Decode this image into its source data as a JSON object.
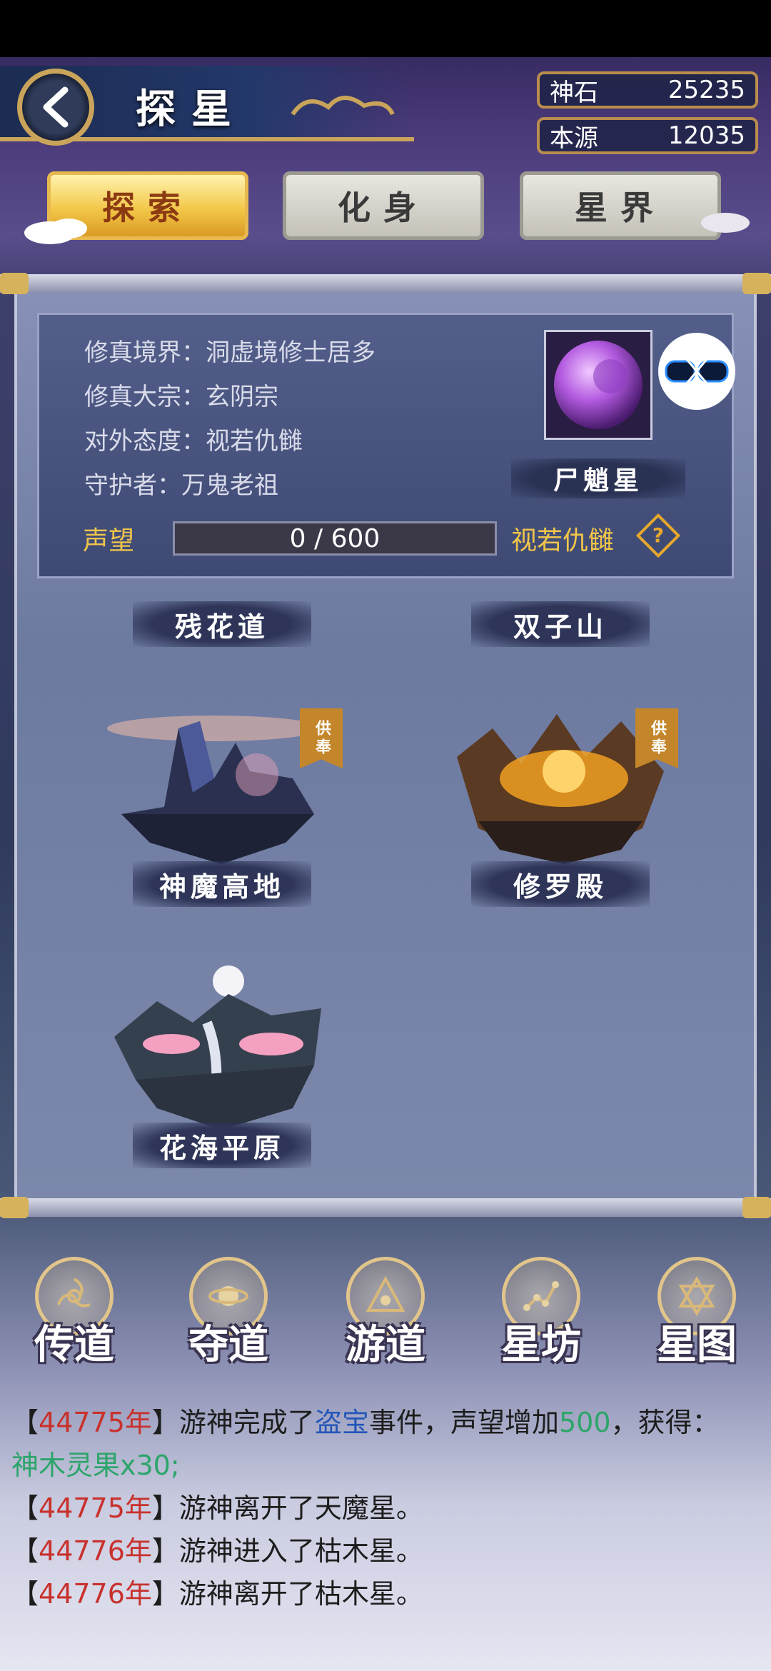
{
  "header": {
    "title": "探星"
  },
  "resources": [
    {
      "name": "神石",
      "value": "25235"
    },
    {
      "name": "本源",
      "value": "12035"
    }
  ],
  "tabs": [
    {
      "label": "探索",
      "active": true
    },
    {
      "label": "化身",
      "active": false
    },
    {
      "label": "星界",
      "active": false
    }
  ],
  "planet": {
    "lines": [
      "修真境界：洞虚境修士居多",
      "修真大宗：玄阴宗",
      "对外态度：视若仇雠",
      "守护者：万鬼老祖"
    ],
    "name": "尸魈星",
    "reputation_label": "声望",
    "reputation_value": "0 / 600",
    "reputation_progress": 0,
    "attitude": "视若仇雠",
    "help": "?"
  },
  "places": [
    {
      "name": "残花道",
      "tribute": ""
    },
    {
      "name": "双子山",
      "tribute": ""
    },
    {
      "name": "神魔高地",
      "tribute": "供奉"
    },
    {
      "name": "修罗殿",
      "tribute": "供奉"
    },
    {
      "name": "花海平原",
      "tribute": ""
    }
  ],
  "nav": [
    {
      "label": "传道",
      "icon": "triskelion-icon"
    },
    {
      "label": "夺道",
      "icon": "orbit-icon"
    },
    {
      "label": "游道",
      "icon": "triangle-star-icon"
    },
    {
      "label": "星坊",
      "icon": "constellation-icon"
    },
    {
      "label": "星图",
      "icon": "hexagram-icon"
    }
  ],
  "log": [
    {
      "open": "【",
      "year": "44775年",
      "close": "】",
      "parts": [
        "游神完成了",
        "盗宝",
        "事件，声望增加",
        "500",
        "，获得：",
        "神木灵果x30;"
      ]
    },
    {
      "open": "【",
      "year": "44775年",
      "close": "】",
      "text": "游神离开了天魔星。"
    },
    {
      "open": "【",
      "year": "44776年",
      "close": "】",
      "text": "游神进入了枯木星。"
    },
    {
      "open": "【",
      "year": "44776年",
      "close": "】",
      "text": "游神离开了枯木星。"
    }
  ],
  "colors": {
    "gold": "#f1c54a",
    "year_red": "#c8312c",
    "event_blue": "#2456b8",
    "gain_green": "#2da56a"
  }
}
